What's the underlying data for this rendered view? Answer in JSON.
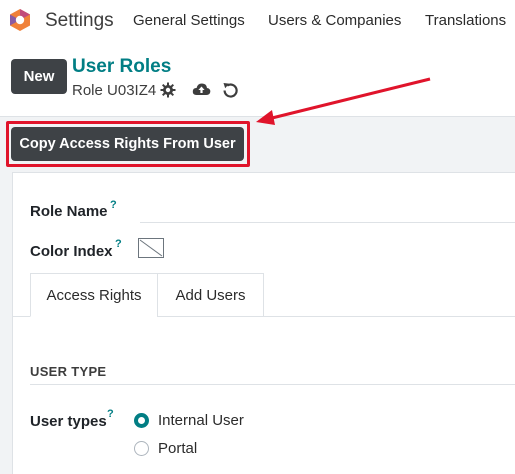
{
  "nav": {
    "app_name": "Settings",
    "items": [
      "General Settings",
      "Users & Companies",
      "Translations"
    ]
  },
  "control_panel": {
    "new_label": "New",
    "breadcrumb_title": "User Roles",
    "record_name": "Role U03IZ4"
  },
  "status": {
    "copy_button_label": "Copy Access Rights From User"
  },
  "form": {
    "role_name_label": "Role Name",
    "role_name_value": "",
    "color_index_label": "Color Index",
    "help_mark": "?",
    "tabs": [
      "Access Rights",
      "Add Users"
    ],
    "active_tab": "Access Rights",
    "section_title": "USER TYPE",
    "user_types_label": "User types",
    "user_type_options": [
      "Internal User",
      "Portal"
    ],
    "selected_user_type": "Internal User"
  },
  "colors": {
    "accent": "#017e84",
    "dark_button": "#3e4246",
    "highlight": "#e0142b"
  },
  "icons": [
    "odoo-logo-icon",
    "gear-icon",
    "cloud-upload-icon",
    "undo-icon",
    "annotation-arrow"
  ]
}
